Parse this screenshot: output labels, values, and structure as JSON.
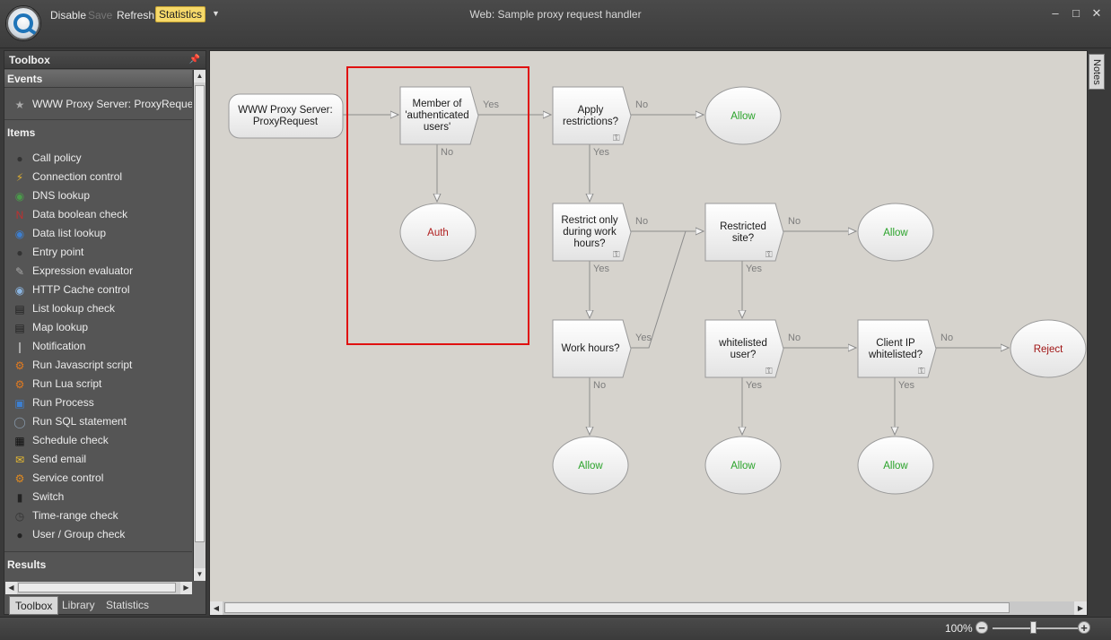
{
  "titlebar": {
    "disable": "Disable",
    "save": "Save",
    "refresh": "Refresh",
    "statistics": "Statistics",
    "title": "Web: Sample proxy request handler"
  },
  "toolbox": {
    "title": "Toolbox",
    "events_header": "Events",
    "events": [
      {
        "label": "WWW Proxy Server: ProxyRequest",
        "icon": "star-icon"
      }
    ],
    "items_header": "Items",
    "items": [
      {
        "label": "Call policy",
        "icon": "call-policy-icon"
      },
      {
        "label": "Connection control",
        "icon": "connection-control-icon"
      },
      {
        "label": "DNS lookup",
        "icon": "dns-lookup-icon"
      },
      {
        "label": "Data boolean check",
        "icon": "boolean-check-icon"
      },
      {
        "label": "Data list lookup",
        "icon": "globe-icon"
      },
      {
        "label": "Entry point",
        "icon": "entry-point-icon"
      },
      {
        "label": "Expression evaluator",
        "icon": "pen-icon"
      },
      {
        "label": "HTTP Cache control",
        "icon": "cache-globe-icon"
      },
      {
        "label": "List lookup check",
        "icon": "list-icon"
      },
      {
        "label": "Map lookup",
        "icon": "map-icon"
      },
      {
        "label": "Notification",
        "icon": "notification-icon"
      },
      {
        "label": "Run Javascript script",
        "icon": "gear-icon"
      },
      {
        "label": "Run Lua script",
        "icon": "gear-icon"
      },
      {
        "label": "Run Process",
        "icon": "process-icon"
      },
      {
        "label": "Run SQL statement",
        "icon": "sql-icon"
      },
      {
        "label": "Schedule check",
        "icon": "calendar-icon"
      },
      {
        "label": "Send email",
        "icon": "envelope-icon"
      },
      {
        "label": "Service control",
        "icon": "service-gears-icon"
      },
      {
        "label": "Switch",
        "icon": "switch-icon"
      },
      {
        "label": "Time-range check",
        "icon": "clock-icon"
      },
      {
        "label": "User / Group check",
        "icon": "user-icon"
      }
    ],
    "results_header": "Results"
  },
  "bottom_tabs": [
    "Toolbox",
    "Library",
    "Statistics"
  ],
  "notes_tab": "Notes",
  "zoom": "100%",
  "flow": {
    "start": [
      "WWW Proxy Server:",
      "ProxyRequest"
    ],
    "member": [
      "Member of",
      "'authenticated",
      "users'"
    ],
    "apply": [
      "Apply",
      "restrictions?"
    ],
    "restrict_work": [
      "Restrict only",
      "during work",
      "hours?"
    ],
    "restricted_site": [
      "Restricted",
      "site?"
    ],
    "work_hours": [
      "Work hours?"
    ],
    "whitelisted_user": [
      "whitelisted",
      "user?"
    ],
    "client_ip": [
      "Client IP",
      "whitelisted?"
    ],
    "auth": "Auth",
    "allow": "Allow",
    "reject": "Reject",
    "yes": "Yes",
    "no": "No"
  },
  "colors": {
    "allow_text": "#2aa32a",
    "reject_text": "#a01414",
    "highlight_box": "#e01010",
    "statistics_active": "#f6d96a"
  }
}
